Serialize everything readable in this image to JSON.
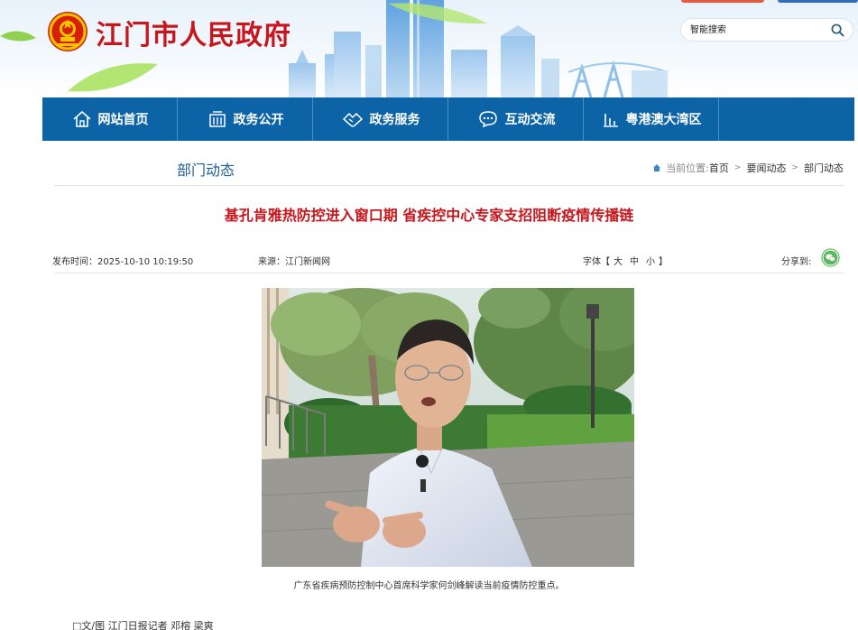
{
  "header": {
    "site_title": "江门市人民政府",
    "search_placeholder": "智能搜索"
  },
  "nav": {
    "items": [
      {
        "label": "网站首页",
        "icon": "home-icon"
      },
      {
        "label": "政务公开",
        "icon": "building-icon"
      },
      {
        "label": "政务服务",
        "icon": "handshake-icon"
      },
      {
        "label": "互动交流",
        "icon": "chat-icon"
      },
      {
        "label": "粤港澳大湾区",
        "icon": "bar-chart-icon"
      }
    ]
  },
  "section": {
    "title": "部门动态"
  },
  "breadcrumb": {
    "prefix": "当前位置:",
    "items": [
      "首页",
      "要闻动态",
      "部门动态"
    ]
  },
  "article": {
    "title": "基孔肯雅热防控进入窗口期 省疾控中心专家支招阻断疫情传播链",
    "publish_time": "发布时间：2025-10-10 10:19:50",
    "source": "来源：江门新闻网",
    "font_label": "字体【",
    "font_large": "大",
    "font_medium": "中",
    "font_small": "小",
    "font_close": "】",
    "share_label": "分享到:",
    "image_caption": "广东省疾病预防控制中心首席科学家何剑峰解读当前疫情防控重点。",
    "byline": "□文/图 江门日报记者 邓榕 梁爽"
  },
  "colors": {
    "brand_red": "#c8161d",
    "nav_blue": "#0c64a6",
    "section_blue": "#1a5f9a",
    "share_green": "#5cb85c"
  }
}
